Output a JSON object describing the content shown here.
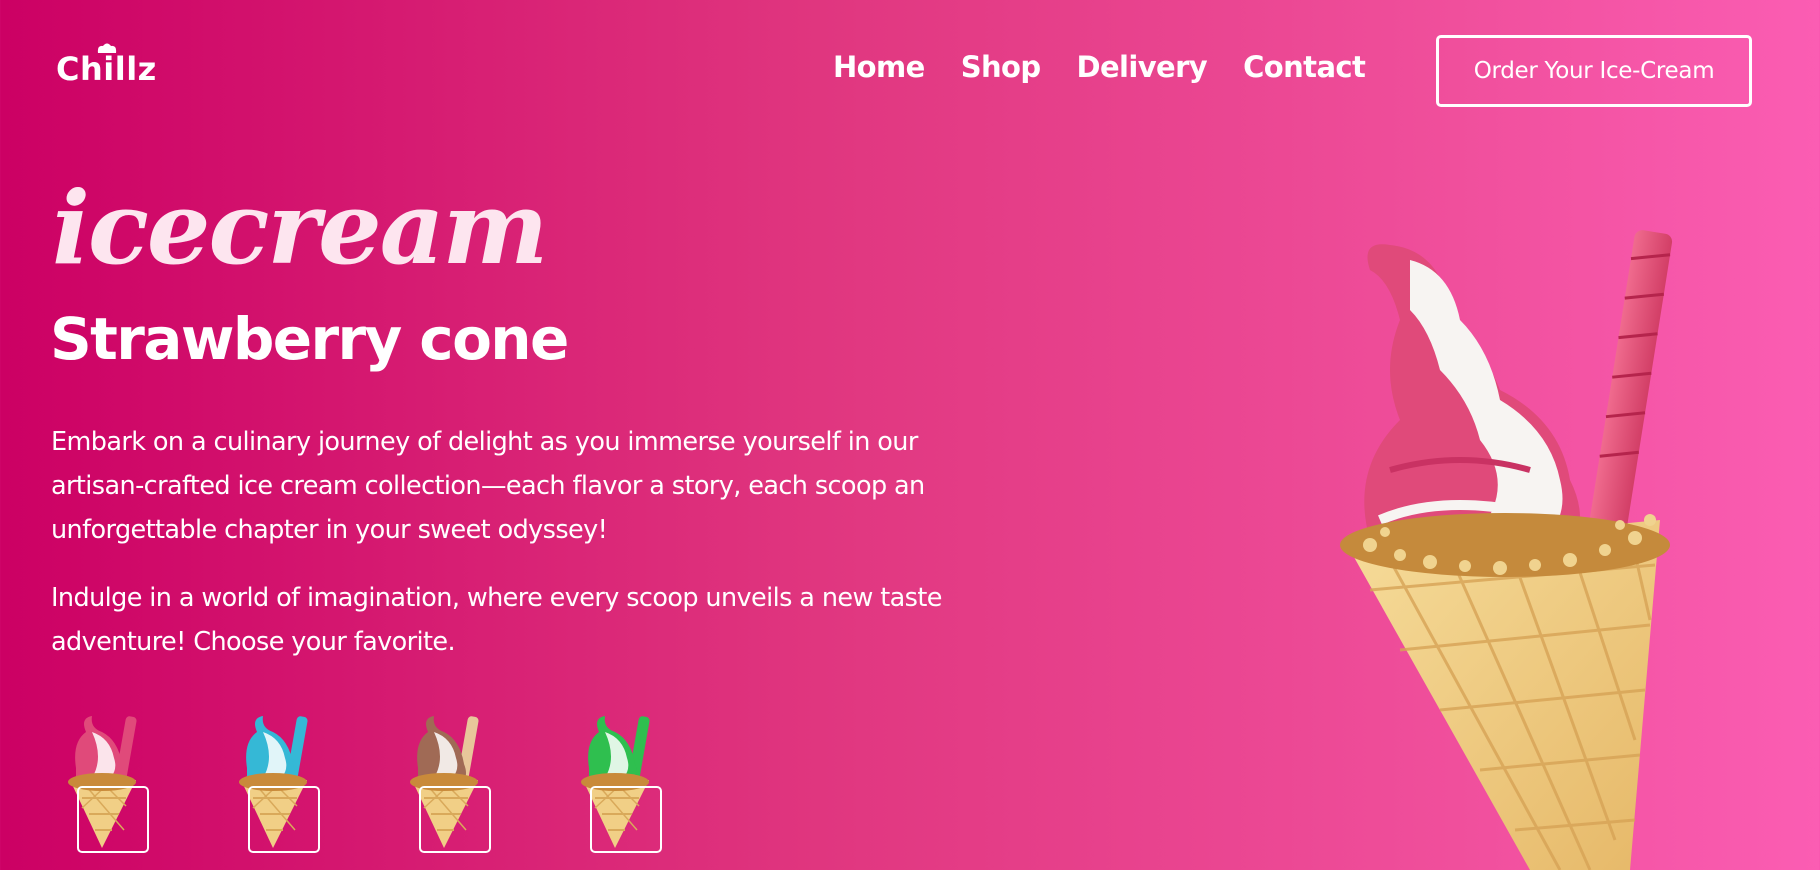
{
  "header": {
    "logo_text": "Chillz",
    "nav": [
      {
        "label": "Home"
      },
      {
        "label": "Shop"
      },
      {
        "label": "Delivery"
      },
      {
        "label": "Contact"
      }
    ],
    "cta_label": "Order Your Ice-Cream"
  },
  "hero": {
    "script_word": "icecream",
    "title": "Strawberry cone",
    "paragraph_1": "Embark on a culinary journey of delight as you immerse yourself in our artisan-crafted ice cream collection—each flavor a story, each scoop an unforgettable chapter in your sweet odyssey!",
    "paragraph_2": "Indulge in a world of imagination, where every scoop unveils a new taste adventure! Choose your favorite."
  },
  "colors": {
    "bg_start": "#cc0064",
    "bg_end": "#fb5db3",
    "strawberry": "#e04a7a",
    "blue": "#35b8d6",
    "chocolate": "#a06a55",
    "mint": "#2fbf4f",
    "cone": "#f1cf86"
  },
  "flavor_thumbs": [
    {
      "icon": "strawberry-cone-icon",
      "color": "#e04a7a"
    },
    {
      "icon": "blueberry-cone-icon",
      "color": "#35b8d6"
    },
    {
      "icon": "chocolate-cone-icon",
      "color": "#a06a55"
    },
    {
      "icon": "mint-cone-icon",
      "color": "#2fbf4f"
    }
  ]
}
